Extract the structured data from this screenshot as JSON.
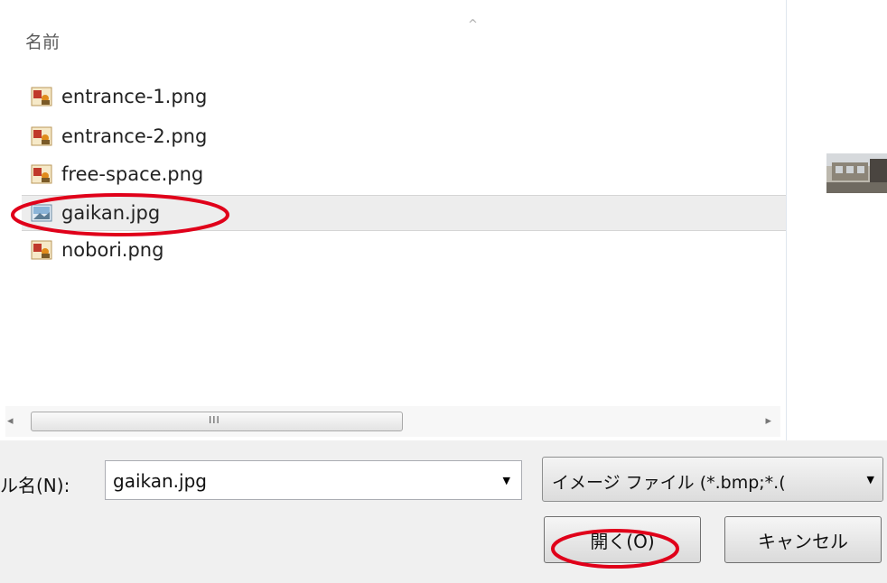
{
  "list": {
    "column_header": "名前",
    "sort_arrow": "^",
    "files": [
      {
        "name": "entrance-1.png",
        "icon": "png-image-icon"
      },
      {
        "name": "entrance-2.png",
        "icon": "png-image-icon"
      },
      {
        "name": "free-space.png",
        "icon": "png-image-icon"
      },
      {
        "name": "gaikan.jpg",
        "icon": "jpg-image-icon",
        "selected": true
      },
      {
        "name": "nobori.png",
        "icon": "png-image-icon"
      }
    ]
  },
  "scrollbar": {
    "left_arrow": "◂",
    "right_arrow": "▸",
    "grip": "III"
  },
  "filename": {
    "label": "ル名(N):",
    "value": "gaikan.jpg"
  },
  "filter": {
    "value": "イメージ ファイル (*.bmp;*.("
  },
  "buttons": {
    "open": "開く(O)",
    "cancel": "キャンセル"
  },
  "colors": {
    "annotation": "#e0001a",
    "selection": "#ededed"
  }
}
